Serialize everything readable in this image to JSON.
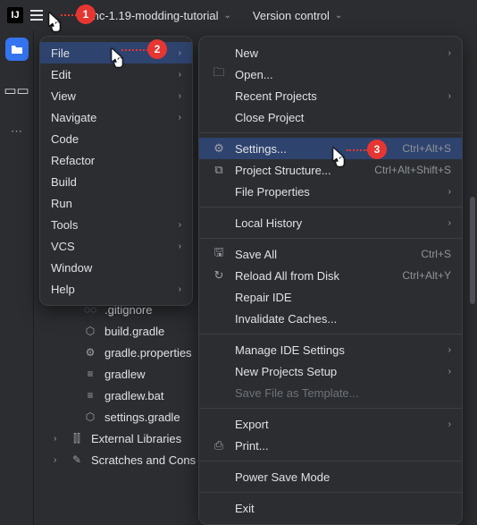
{
  "annotations": {
    "step1": "1",
    "step2": "2",
    "step3": "3"
  },
  "topbar": {
    "project_name": "mc-1.19-modding-tutorial",
    "version_control": "Version control"
  },
  "main_menu": [
    {
      "label": "File",
      "has_sub": true,
      "highlight": true
    },
    {
      "label": "Edit",
      "has_sub": true
    },
    {
      "label": "View",
      "has_sub": true
    },
    {
      "label": "Navigate",
      "has_sub": true
    },
    {
      "label": "Code",
      "has_sub": false
    },
    {
      "label": "Refactor",
      "has_sub": false
    },
    {
      "label": "Build",
      "has_sub": false
    },
    {
      "label": "Run",
      "has_sub": false
    },
    {
      "label": "Tools",
      "has_sub": true
    },
    {
      "label": "VCS",
      "has_sub": true
    },
    {
      "label": "Window",
      "has_sub": false
    },
    {
      "label": "Help",
      "has_sub": true
    }
  ],
  "file_menu": {
    "s0": [
      {
        "label": "New",
        "has_sub": true,
        "icon": ""
      },
      {
        "label": "Open...",
        "has_sub": false,
        "icon": "folder"
      },
      {
        "label": "Recent Projects",
        "has_sub": true,
        "icon": ""
      },
      {
        "label": "Close Project",
        "has_sub": false,
        "icon": ""
      }
    ],
    "s1": [
      {
        "label": "Settings...",
        "has_sub": false,
        "icon": "gear",
        "shortcut": "Ctrl+Alt+S",
        "highlight": true
      },
      {
        "label": "Project Structure...",
        "has_sub": false,
        "icon": "struct",
        "shortcut": "Ctrl+Alt+Shift+S"
      },
      {
        "label": "File Properties",
        "has_sub": true,
        "icon": ""
      }
    ],
    "s2": [
      {
        "label": "Local History",
        "has_sub": true,
        "icon": ""
      }
    ],
    "s3": [
      {
        "label": "Save All",
        "icon": "save",
        "shortcut": "Ctrl+S"
      },
      {
        "label": "Reload All from Disk",
        "icon": "reload",
        "shortcut": "Ctrl+Alt+Y"
      },
      {
        "label": "Repair IDE",
        "icon": ""
      },
      {
        "label": "Invalidate Caches...",
        "icon": ""
      }
    ],
    "s4": [
      {
        "label": "Manage IDE Settings",
        "has_sub": true,
        "icon": ""
      },
      {
        "label": "New Projects Setup",
        "has_sub": true,
        "icon": ""
      },
      {
        "label": "Save File as Template...",
        "icon": "",
        "disabled": true
      }
    ],
    "s5": [
      {
        "label": "Export",
        "has_sub": true,
        "icon": ""
      },
      {
        "label": "Print...",
        "icon": "print"
      }
    ],
    "s6": [
      {
        "label": "Power Save Mode",
        "icon": ""
      }
    ],
    "s7": [
      {
        "label": "Exit",
        "icon": ""
      }
    ]
  },
  "project_tree": {
    "files": [
      {
        "name": ".gitignore",
        "icon": "git"
      },
      {
        "name": "build.gradle",
        "icon": "gradle"
      },
      {
        "name": "gradle.properties",
        "icon": "gear"
      },
      {
        "name": "gradlew",
        "icon": "file"
      },
      {
        "name": "gradlew.bat",
        "icon": "file"
      },
      {
        "name": "settings.gradle",
        "icon": "gradle"
      }
    ],
    "roots": [
      {
        "name": "External Libraries",
        "icon": "lib"
      },
      {
        "name": "Scratches and Consoles",
        "icon": "scratch",
        "truncated": "Scratches and Cons"
      }
    ]
  }
}
